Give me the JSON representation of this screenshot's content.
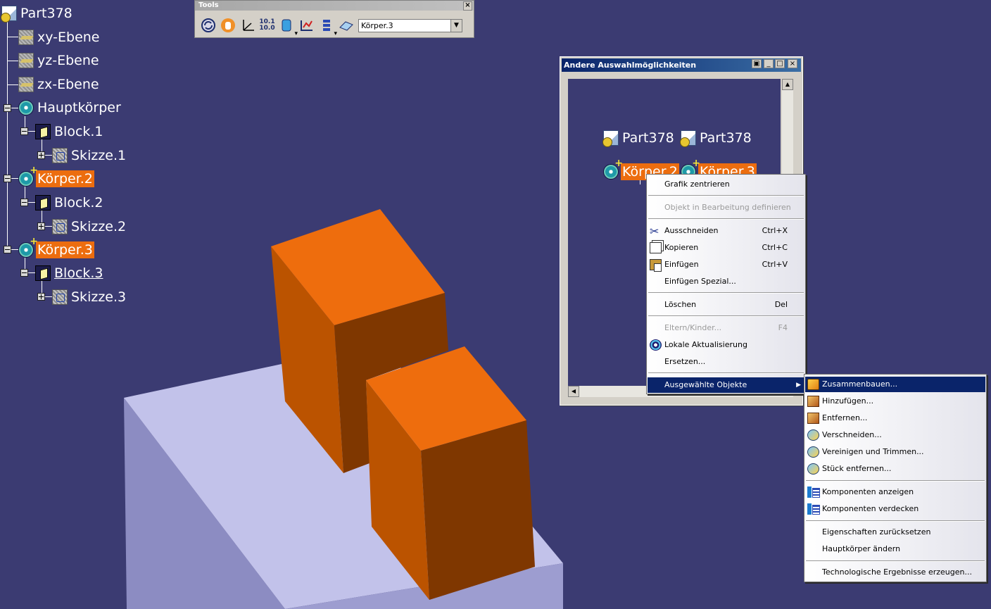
{
  "tree": {
    "root": "Part378",
    "planes": [
      "xy-Ebene",
      "yz-Ebene",
      "zx-Ebene"
    ],
    "main_body": "Hauptkörper",
    "block1": "Block.1",
    "sketch1": "Skizze.1",
    "body2": "Körper.2",
    "block2": "Block.2",
    "sketch2": "Skizze.2",
    "body3": "Körper.3",
    "block3": "Block.3",
    "sketch3": "Skizze.3"
  },
  "tools": {
    "title": "Tools",
    "close": "×",
    "select_value": "Körper.3",
    "axis_label_top": "10.1",
    "axis_label_bottom": "10.0",
    "icons": [
      "update-icon",
      "hand-icon",
      "axis-system-icon",
      "numeric-display-icon",
      "body-insert-icon",
      "analysis-icon",
      "list-icon",
      "plane-icon"
    ]
  },
  "dialog": {
    "title": "Andere Auswahlmöglichkeiten",
    "left_part": "Part378",
    "left_body": "Körper.2",
    "right_part": "Part378",
    "right_body": "Körper.3"
  },
  "context_menu": {
    "items": [
      {
        "label": "Grafik zentrieren",
        "shortcut": ""
      },
      {
        "label": "Objekt in Bearbeitung definieren",
        "shortcut": "",
        "disabled": true
      },
      {
        "label": "Ausschneiden",
        "shortcut": "Ctrl+X"
      },
      {
        "label": "Kopieren",
        "shortcut": "Ctrl+C"
      },
      {
        "label": "Einfügen",
        "shortcut": "Ctrl+V"
      },
      {
        "label": "Einfügen Spezial...",
        "shortcut": ""
      },
      {
        "label": "Löschen",
        "shortcut": "Del"
      },
      {
        "label": "Eltern/Kinder...",
        "shortcut": "F4",
        "disabled": true
      },
      {
        "label": "Lokale Aktualisierung",
        "shortcut": ""
      },
      {
        "label": "Ersetzen...",
        "shortcut": ""
      },
      {
        "label": "Ausgewählte Objekte",
        "shortcut": "",
        "submenu": true
      }
    ]
  },
  "submenu": {
    "items": [
      {
        "label": "Zusammenbauen..."
      },
      {
        "label": "Hinzufügen..."
      },
      {
        "label": "Entfernen..."
      },
      {
        "label": "Verschneiden..."
      },
      {
        "label": "Vereinigen und Trimmen..."
      },
      {
        "label": "Stück entfernen..."
      },
      {
        "label": "Komponenten anzeigen"
      },
      {
        "label": "Komponenten verdecken"
      },
      {
        "label": "Eigenschaften zurücksetzen"
      },
      {
        "label": "Hauptkörper ändern"
      },
      {
        "label": "Technologische Ergebnisse erzeugen..."
      }
    ]
  },
  "colors": {
    "background": "#3b3b72",
    "selection": "#ec6d0f",
    "solid_front": "#7a3300",
    "solid_side": "#b65000",
    "solid_top": "#ec6d0f",
    "base_plate": "#b9b9e4",
    "menu_highlight": "#0a246a"
  }
}
